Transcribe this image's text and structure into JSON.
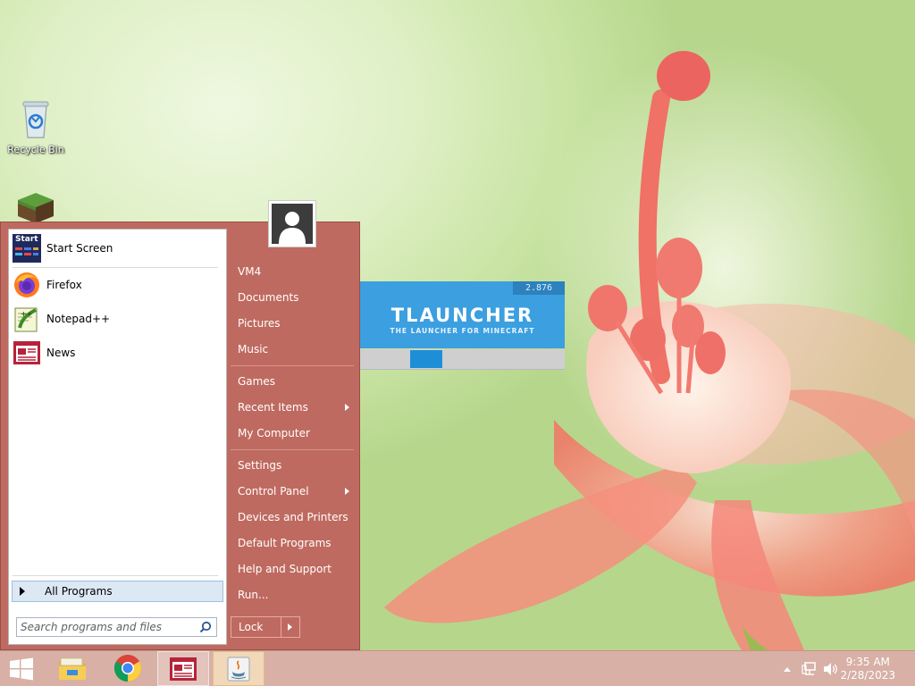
{
  "desktop": {
    "icons": [
      {
        "label": "Recycle Bin",
        "icon": "recycle-bin-icon"
      },
      {
        "label": "",
        "icon": "minecraft-block-icon"
      }
    ]
  },
  "splash": {
    "version": "2.876",
    "title": "TLAUNCHER",
    "subtitle": "THE LAUNCHER FOR MINECRAFT",
    "progress_color": "#1e8fd7",
    "header_color": "#3b9fe0"
  },
  "start_menu": {
    "accent_color": "#bf6a60",
    "pinned": [
      {
        "label": "Start Screen",
        "icon": "start-screen-icon",
        "icon_text": "Start"
      },
      {
        "label": "Firefox",
        "icon": "firefox-icon"
      },
      {
        "label": "Notepad++",
        "icon": "notepad-plus-plus-icon"
      },
      {
        "label": "News",
        "icon": "news-icon"
      }
    ],
    "all_programs": "All Programs",
    "search_placeholder": "Search programs and files",
    "right_items": [
      {
        "label": "VM4",
        "submenu": false
      },
      {
        "label": "Documents",
        "submenu": false
      },
      {
        "label": "Pictures",
        "submenu": false
      },
      {
        "label": "Music",
        "submenu": false
      },
      {
        "label": "Games",
        "submenu": false
      },
      {
        "label": "Recent Items",
        "submenu": true
      },
      {
        "label": "My Computer",
        "submenu": false
      },
      {
        "label": "Settings",
        "submenu": false
      },
      {
        "label": "Control Panel",
        "submenu": true
      },
      {
        "label": "Devices and Printers",
        "submenu": false
      },
      {
        "label": "Default Programs",
        "submenu": false
      },
      {
        "label": "Help and Support",
        "submenu": false
      },
      {
        "label": "Run...",
        "submenu": false
      }
    ],
    "lock_label": "Lock"
  },
  "taskbar": {
    "buttons": [
      {
        "name": "start-button",
        "icon": "windows-logo-icon"
      },
      {
        "name": "file-explorer-button",
        "icon": "folder-icon"
      },
      {
        "name": "chrome-button",
        "icon": "chrome-icon"
      },
      {
        "name": "news-button",
        "icon": "news-icon"
      },
      {
        "name": "java-button",
        "icon": "java-icon"
      }
    ],
    "tray_icons": [
      "show-hidden-icons-chevron-icon",
      "network-icon",
      "volume-icon"
    ],
    "clock_time": "9:35 AM",
    "clock_date": "2/28/2023"
  }
}
